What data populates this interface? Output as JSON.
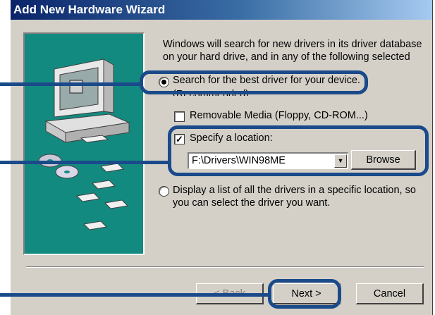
{
  "window": {
    "title": "Add New Hardware Wizard"
  },
  "intro_text": "Windows will search for new drivers in its driver database on your hard drive, and in any of the following selected",
  "options": {
    "search_best": {
      "label": "Search for the best driver for your device.",
      "sublabel": "(Recommended).",
      "selected": true
    },
    "removable_media": {
      "label": "Removable Media (Floppy, CD-ROM...)",
      "checked": false
    },
    "specify_location": {
      "label": "Specify a location:",
      "checked": true,
      "value": "F:\\Drivers\\WIN98ME"
    },
    "display_list": {
      "label": "Display a list of all the drivers in a specific location, so you can select the driver you want.",
      "selected": false
    }
  },
  "buttons": {
    "browse": "Browse",
    "back": "< Back",
    "next": "Next >",
    "cancel": "Cancel"
  },
  "colors": {
    "highlight": "#1a4a8a",
    "art_bg": "#138a80",
    "title_bar": "#0a246a"
  }
}
